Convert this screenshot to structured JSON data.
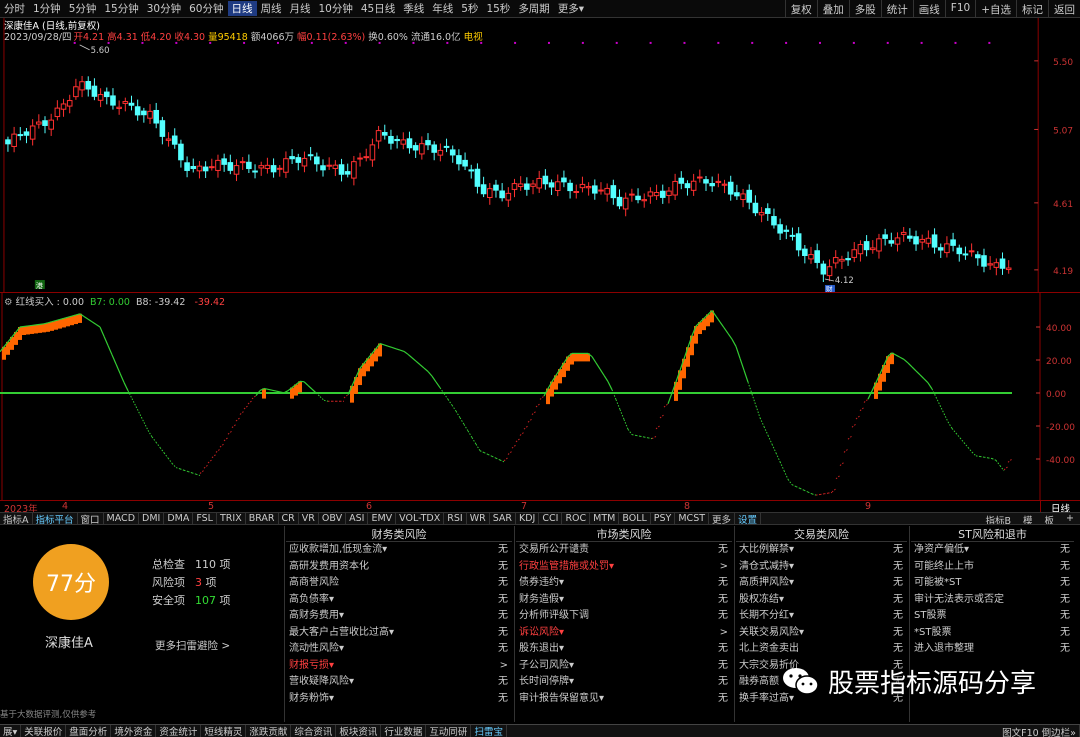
{
  "toolbar": {
    "periods": [
      "分时",
      "1分钟",
      "5分钟",
      "15分钟",
      "30分钟",
      "60分钟",
      "日线",
      "周线",
      "月线",
      "10分钟",
      "45日线",
      "季线",
      "年线",
      "5秒",
      "15秒",
      "多周期",
      "更多▾"
    ],
    "active_period": "日线",
    "right_buttons": [
      "复权",
      "叠加",
      "多股",
      "统计",
      "画线",
      "F10",
      "+自选",
      "标记",
      "返回"
    ]
  },
  "info": {
    "name_mode": "深康佳A (日线,前复权)",
    "date": "2023/09/28/四",
    "open": "开4.21",
    "high": "高4.31",
    "low": "低4.20",
    "close": "收4.30",
    "volume": "量95418",
    "amount": "额4066万",
    "change": "幅0.11(2.63%)",
    "turnover": "换0.60%",
    "float_cap": "流通16.0亿",
    "tv": "电视"
  },
  "price_axis": [
    "5.50",
    "5.07",
    "4.61",
    "4.19"
  ],
  "annotations": {
    "high": "5.60",
    "low": "4.12",
    "cai": "财",
    "gang": "港"
  },
  "indicator": {
    "name": "红线买入",
    "v0": ": 0.00",
    "b7": "B7: 0.00",
    "b8": "B8: -39.42",
    "b8v": "-39.42",
    "axis": [
      "40.00",
      "20.00",
      "0.00",
      "-20.00",
      "-40.00"
    ]
  },
  "dates": {
    "year": "2023年",
    "m4": "4",
    "m5": "5",
    "m6": "6",
    "m7": "7",
    "m8": "8",
    "m9": "9",
    "right": "日线"
  },
  "indicator_tabs": [
    "指标A",
    "指标平台",
    "窗口",
    "MACD",
    "DMI",
    "DMA",
    "FSL",
    "TRIX",
    "BRAR",
    "CR",
    "VR",
    "OBV",
    "ASI",
    "EMV",
    "VOL-TDX",
    "RSI",
    "WR",
    "SAR",
    "KDJ",
    "CCI",
    "ROC",
    "MTM",
    "BOLL",
    "PSY",
    "MCST",
    "更多",
    "设置"
  ],
  "indicator_tabs_right": [
    "指标B",
    "模",
    "板",
    "+"
  ],
  "risk": {
    "score": "77分",
    "stock_name": "深康佳A",
    "total_label": "总检查",
    "total": "110",
    "total_unit": "项",
    "risk_label": "风险项",
    "risk_count": "3",
    "risk_unit": "项",
    "safe_label": "安全项",
    "safe": "107",
    "safe_unit": "项",
    "more": "更多扫雷避险 >",
    "disclaimer": "基于大数据评测,仅供参考",
    "columns": [
      {
        "title": "财务类风险",
        "items": [
          {
            "label": "应收款增加,低现金流▾",
            "value": "无",
            "red": false
          },
          {
            "label": "高研发费用资本化",
            "value": "无",
            "red": false
          },
          {
            "label": "高商誉风险",
            "value": "无",
            "red": false
          },
          {
            "label": "高负债率▾",
            "value": "无",
            "red": false
          },
          {
            "label": "高财务费用▾",
            "value": "无",
            "red": false
          },
          {
            "label": "最大客户占营收比过高▾",
            "value": "无",
            "red": false
          },
          {
            "label": "流动性风险▾",
            "value": "无",
            "red": false
          },
          {
            "label": "财报亏损▾",
            "value": ">",
            "red": true
          },
          {
            "label": "营收疑降风险▾",
            "value": "无",
            "red": false
          },
          {
            "label": "财务粉饰▾",
            "value": "无",
            "red": false
          }
        ]
      },
      {
        "title": "市场类风险",
        "items": [
          {
            "label": "交易所公开谴责",
            "value": "无",
            "red": false
          },
          {
            "label": "行政监管措施或处罚▾",
            "value": ">",
            "red": true
          },
          {
            "label": "债券违约▾",
            "value": "无",
            "red": false
          },
          {
            "label": "财务造假▾",
            "value": "无",
            "red": false
          },
          {
            "label": "分析师评级下调",
            "value": "无",
            "red": false
          },
          {
            "label": "诉讼风险▾",
            "value": ">",
            "red": true
          },
          {
            "label": "股东退出▾",
            "value": "无",
            "red": false
          },
          {
            "label": "子公司风险▾",
            "value": "无",
            "red": false
          },
          {
            "label": "长时间停牌▾",
            "value": "无",
            "red": false
          },
          {
            "label": "审计报告保留意见▾",
            "value": "无",
            "red": false
          }
        ]
      },
      {
        "title": "交易类风险",
        "items": [
          {
            "label": "大比例解禁▾",
            "value": "无",
            "red": false
          },
          {
            "label": "清仓式减持▾",
            "value": "无",
            "red": false
          },
          {
            "label": "高质押风险▾",
            "value": "无",
            "red": false
          },
          {
            "label": "股权冻结▾",
            "value": "无",
            "red": false
          },
          {
            "label": "长期不分红▾",
            "value": "无",
            "red": false
          },
          {
            "label": "关联交易风险▾",
            "value": "无",
            "red": false
          },
          {
            "label": "北上资金卖出",
            "value": "无",
            "red": false
          },
          {
            "label": "大宗交易折价",
            "value": "无",
            "red": false
          },
          {
            "label": "融券高额",
            "value": "无",
            "red": false
          },
          {
            "label": "换手率过高▾",
            "value": "无",
            "red": false
          }
        ]
      },
      {
        "title": "ST风险和退市",
        "items": [
          {
            "label": "净资产偏低▾",
            "value": "无",
            "red": false
          },
          {
            "label": "可能终止上市",
            "value": "无",
            "red": false
          },
          {
            "label": "可能被*ST",
            "value": "无",
            "red": false
          },
          {
            "label": "审计无法表示或否定",
            "value": "无",
            "red": false
          },
          {
            "label": "ST股票",
            "value": "无",
            "red": false
          },
          {
            "label": "*ST股票",
            "value": "无",
            "red": false
          },
          {
            "label": "进入退市整理",
            "value": "无",
            "red": false
          }
        ]
      }
    ]
  },
  "bottom_tabs": [
    "展▾",
    "关联报价",
    "盘面分析",
    "境外资金",
    "资金统计",
    "短线精灵",
    "涨跌贡献",
    "综合资讯",
    "板块资讯",
    "行业数据",
    "互动同研",
    "扫雷宝"
  ],
  "bottom_right": "图文F10 倒边栏»",
  "watermark": "股票指标源码分享",
  "colors": {
    "up": "#ff3030",
    "down": "#54ffff",
    "ma": "#ffffff",
    "osc_up": "#ff6600",
    "osc_green": "#33cc33",
    "osc_red": "#cc2222",
    "score": "#f0a020"
  }
}
